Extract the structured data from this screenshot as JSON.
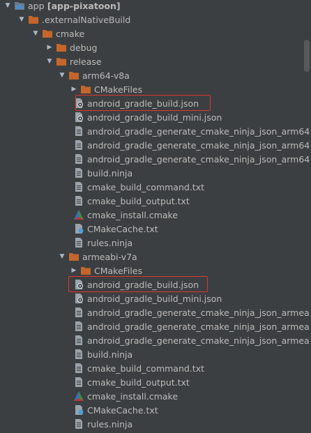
{
  "tree": {
    "items": [
      {
        "label": "app",
        "extra": "[app-pixatoon]",
        "icon": "module-folder-icon",
        "arrow": "down"
      },
      {
        "label": ".externalNativeBuild",
        "icon": "folder-icon",
        "arrow": "down"
      },
      {
        "label": "cmake",
        "icon": "folder-icon",
        "arrow": "down"
      },
      {
        "label": "debug",
        "icon": "folder-icon",
        "arrow": "right"
      },
      {
        "label": "release",
        "icon": "folder-icon",
        "arrow": "down"
      },
      {
        "label": "arm64-v8a",
        "icon": "folder-icon",
        "arrow": "down"
      },
      {
        "label": "CMakeFiles",
        "icon": "folder-icon",
        "arrow": "right"
      },
      {
        "label": "android_gradle_build.json",
        "icon": "json-file-icon"
      },
      {
        "label": "android_gradle_build_mini.json",
        "icon": "json-file-icon"
      },
      {
        "label": "android_gradle_generate_cmake_ninja_json_arm64",
        "icon": "text-file-icon"
      },
      {
        "label": "android_gradle_generate_cmake_ninja_json_arm64",
        "icon": "text-file-icon"
      },
      {
        "label": "android_gradle_generate_cmake_ninja_json_arm64",
        "icon": "text-file-icon"
      },
      {
        "label": "build.ninja",
        "icon": "text-file-icon"
      },
      {
        "label": "cmake_build_command.txt",
        "icon": "text-file-icon"
      },
      {
        "label": "cmake_build_output.txt",
        "icon": "text-file-icon"
      },
      {
        "label": "cmake_install.cmake",
        "icon": "cmake-file-icon"
      },
      {
        "label": "CMakeCache.txt",
        "icon": "cmake-cache-file-icon"
      },
      {
        "label": "rules.ninja",
        "icon": "text-file-icon"
      },
      {
        "label": "armeabi-v7a",
        "icon": "folder-icon",
        "arrow": "down"
      },
      {
        "label": "CMakeFiles",
        "icon": "folder-icon",
        "arrow": "right"
      },
      {
        "label": "android_gradle_build.json",
        "icon": "json-file-icon"
      },
      {
        "label": "android_gradle_build_mini.json",
        "icon": "json-file-icon"
      },
      {
        "label": "android_gradle_generate_cmake_ninja_json_armea",
        "icon": "text-file-icon"
      },
      {
        "label": "android_gradle_generate_cmake_ninja_json_armea",
        "icon": "text-file-icon"
      },
      {
        "label": "android_gradle_generate_cmake_ninja_json_armea",
        "icon": "text-file-icon"
      },
      {
        "label": "build.ninja",
        "icon": "text-file-icon"
      },
      {
        "label": "cmake_build_command.txt",
        "icon": "text-file-icon"
      },
      {
        "label": "cmake_build_output.txt",
        "icon": "text-file-icon"
      },
      {
        "label": "cmake_install.cmake",
        "icon": "cmake-file-icon"
      },
      {
        "label": "CMakeCache.txt",
        "icon": "cmake-cache-file-icon"
      },
      {
        "label": "rules.ninja",
        "icon": "text-file-icon"
      }
    ],
    "highlighted": [
      "android_gradle_build.json (arm64-v8a)",
      "android_gradle_build.json (armeabi-v7a)"
    ]
  },
  "colors": {
    "background": "#3c3f41",
    "text": "#bbbbbb",
    "folder": "#c4662b",
    "highlight_border": "#e0352f"
  }
}
